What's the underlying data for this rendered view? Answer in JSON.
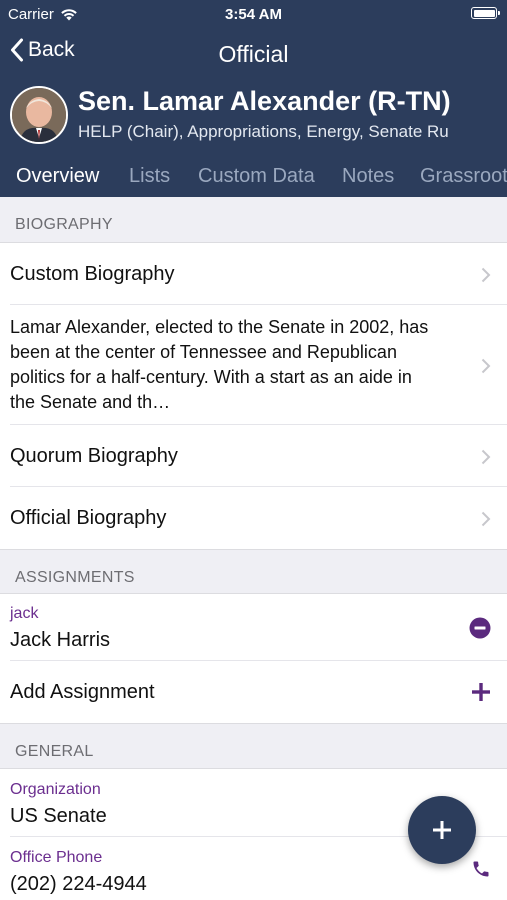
{
  "status_bar": {
    "carrier": "Carrier",
    "time": "3:54 AM"
  },
  "nav": {
    "back_label": "Back",
    "title": "Official"
  },
  "profile": {
    "name": "Sen. Lamar Alexander (R-TN)",
    "committees": "HELP (Chair), Appropriations, Energy, Senate Ru"
  },
  "tabs": [
    {
      "label": "Overview",
      "active": true
    },
    {
      "label": "Lists"
    },
    {
      "label": "Custom Data"
    },
    {
      "label": "Notes"
    },
    {
      "label": "Grassroot"
    }
  ],
  "biography": {
    "header": "BIOGRAPHY",
    "custom_label": "Custom Biography",
    "excerpt": "Lamar Alexander, elected to the Senate in 2002, has been at the center of Tennessee and Republican politics for a half-century. With a start as an aide in the Senate and th…",
    "quorum_label": "Quorum Biography",
    "official_label": "Official Biography"
  },
  "assignments": {
    "header": "ASSIGNMENTS",
    "username": "jack",
    "fullname": "Jack Harris",
    "add_label": "Add Assignment"
  },
  "general": {
    "header": "GENERAL",
    "organization_label": "Organization",
    "organization_value": "US Senate",
    "phone_label": "Office Phone",
    "phone_value": "(202) 224-4944"
  },
  "colors": {
    "header_bg": "#2c3d5c",
    "accent_purple": "#6b2e8f",
    "section_bg": "#efeff4"
  },
  "icons": [
    "wifi-icon",
    "battery-icon",
    "back-chevron-icon",
    "chevron-right-icon",
    "minus-circle-icon",
    "plus-icon",
    "phone-icon",
    "fab-plus-icon"
  ]
}
